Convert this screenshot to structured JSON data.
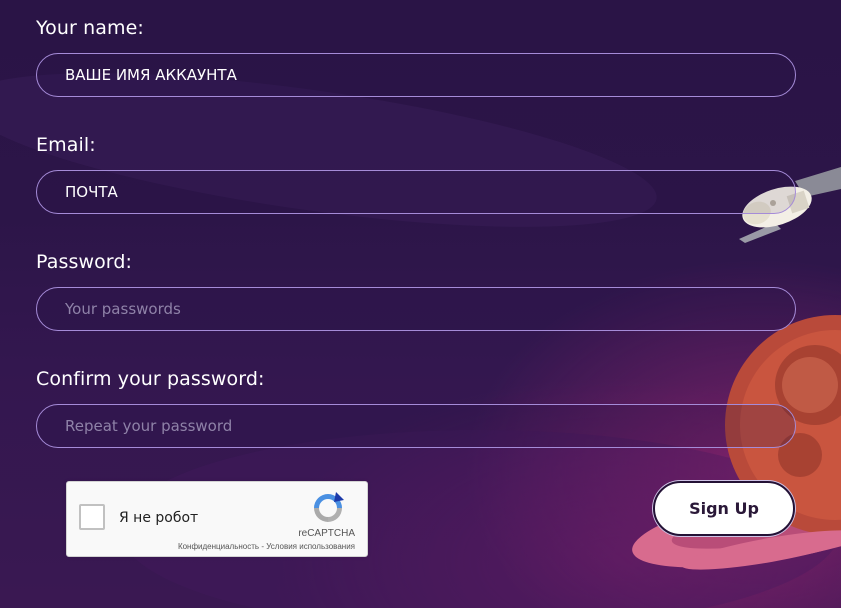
{
  "form": {
    "name": {
      "label": "Your name:",
      "value": "ВАШЕ ИМЯ АККАУНТА"
    },
    "email": {
      "label": "Email:",
      "value": "ПОЧТА"
    },
    "password": {
      "label": "Password:",
      "placeholder": "Your passwords"
    },
    "confirm": {
      "label": "Confirm your password:",
      "placeholder": "Repeat your password"
    }
  },
  "recaptcha": {
    "label": "Я не робот",
    "brand": "reCAPTCHA",
    "privacy": "Конфиденциальность",
    "separator": " - ",
    "terms": "Условия использования"
  },
  "signup": {
    "label": "Sign Up"
  },
  "colors": {
    "background": "#2c1548",
    "field_border": "#a58bd8",
    "planet": "#c0553f",
    "ring": "#d96a8a"
  },
  "icons": [
    "recaptcha-logo-icon",
    "spaceship-icon",
    "planet-icon"
  ]
}
